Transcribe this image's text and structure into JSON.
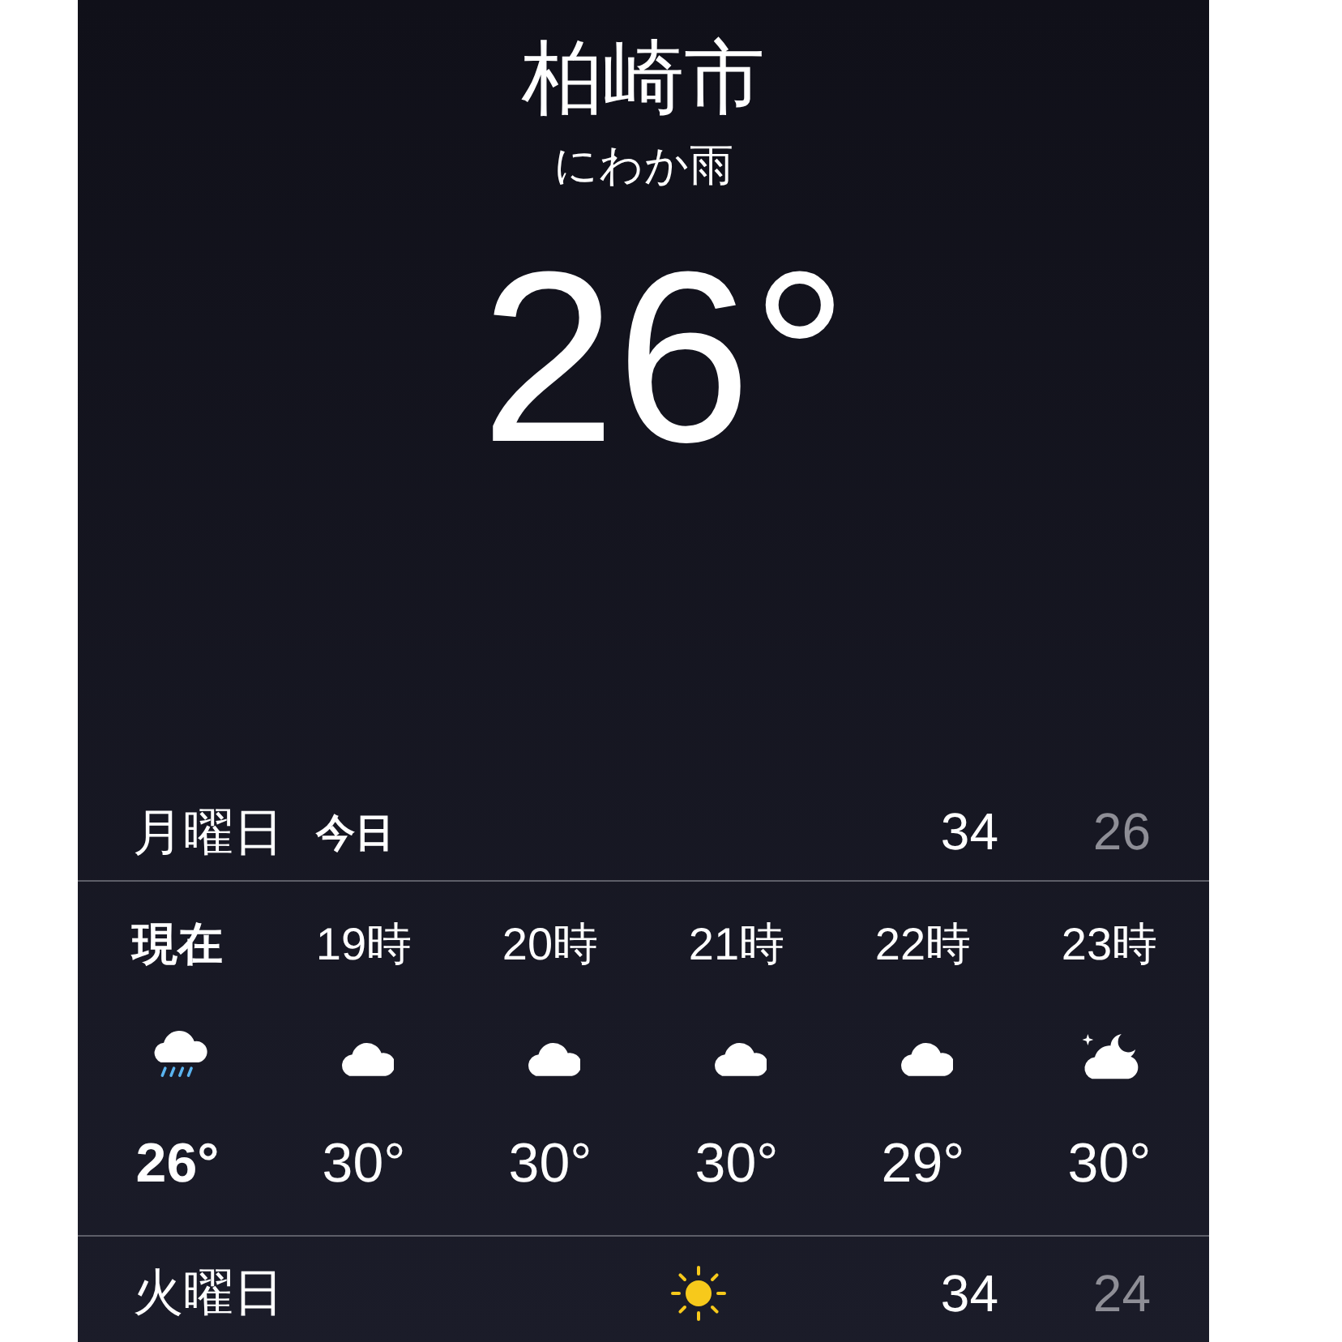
{
  "location": {
    "city": "柏崎市",
    "condition": "にわか雨",
    "temperature": "26°"
  },
  "today": {
    "day": "月曜日",
    "label": "今日",
    "high": "34",
    "low": "26"
  },
  "hourly": [
    {
      "time": "現在",
      "kind": "rain",
      "temperature": "26°",
      "current": true
    },
    {
      "time": "19時",
      "kind": "cloud",
      "temperature": "30°",
      "current": false
    },
    {
      "time": "20時",
      "kind": "cloud",
      "temperature": "30°",
      "current": false
    },
    {
      "time": "21時",
      "kind": "cloud",
      "temperature": "30°",
      "current": false
    },
    {
      "time": "22時",
      "kind": "cloud",
      "temperature": "29°",
      "current": false
    },
    {
      "time": "23時",
      "kind": "night-cloud",
      "temperature": "30°",
      "current": false
    }
  ],
  "next_day": {
    "day": "火曜日",
    "kind": "sun",
    "high": "34",
    "low": "24"
  }
}
